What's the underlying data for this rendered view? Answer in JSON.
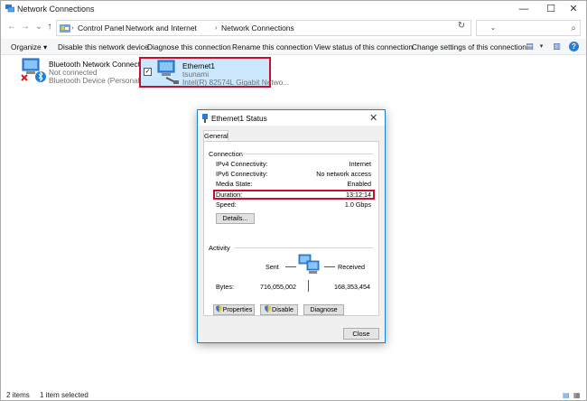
{
  "window": {
    "title": "Network Connections",
    "minimize": "—",
    "maximize": "☐",
    "close": "✕"
  },
  "nav": {
    "back": "←",
    "forward": "→",
    "down": "⌄",
    "up": "↑"
  },
  "address": {
    "crumbs": [
      "Control Panel",
      "Network and Internet",
      "Network Connections"
    ],
    "separator": "›",
    "leading_sep": "›",
    "dropdown": "⌄",
    "refresh": "↻",
    "search_placeholder": "",
    "search_icon": "⌕"
  },
  "toolbar": {
    "organize": "Organize ▾",
    "disable": "Disable this network device",
    "diagnose": "Diagnose this connection",
    "rename": "Rename this connection",
    "view_status": "View status of this connection",
    "change_settings": "Change settings of this connection",
    "view_icon": "▤",
    "view_drop": "▾",
    "pane_icon": "▥",
    "help_icon": "?"
  },
  "connections": [
    {
      "name": "Bluetooth Network Connection",
      "status": "Not connected",
      "device": "Bluetooth Device (Personal Ar...",
      "icon": "bluetooth-network-icon"
    },
    {
      "name": "Ethernet1",
      "status": "tsunami",
      "device": "Intel(R) 82574L Gigabit Netwo...",
      "icon": "ethernet-network-icon",
      "checkbox": "✓"
    }
  ],
  "statusbar": {
    "count": "2 items",
    "selected": "1 item selected"
  },
  "dialog": {
    "title": "Ethernet1 Status",
    "close": "✕",
    "tab": "General",
    "connection_label": "Connection",
    "properties": [
      {
        "key": "IPv4 Connectivity:",
        "value": "Internet"
      },
      {
        "key": "IPv6 Connectivity:",
        "value": "No network access"
      },
      {
        "key": "Media State:",
        "value": "Enabled"
      },
      {
        "key": "Duration:",
        "value": "13:12:14"
      },
      {
        "key": "Speed:",
        "value": "1.0 Gbps"
      }
    ],
    "details_button": "Details...",
    "activity_label": "Activity",
    "sent_label": "Sent",
    "received_label": "Received",
    "bytes_label": "Bytes:",
    "bytes_sent": "716,055,002",
    "bytes_received": "168,353,454",
    "properties_button": "Properties",
    "disable_button": "Disable",
    "diagnose_button": "Diagnose",
    "close_button": "Close"
  },
  "colors": {
    "highlight": "#c8102e",
    "selection": "#cce8ff",
    "accent": "#1883d7"
  }
}
